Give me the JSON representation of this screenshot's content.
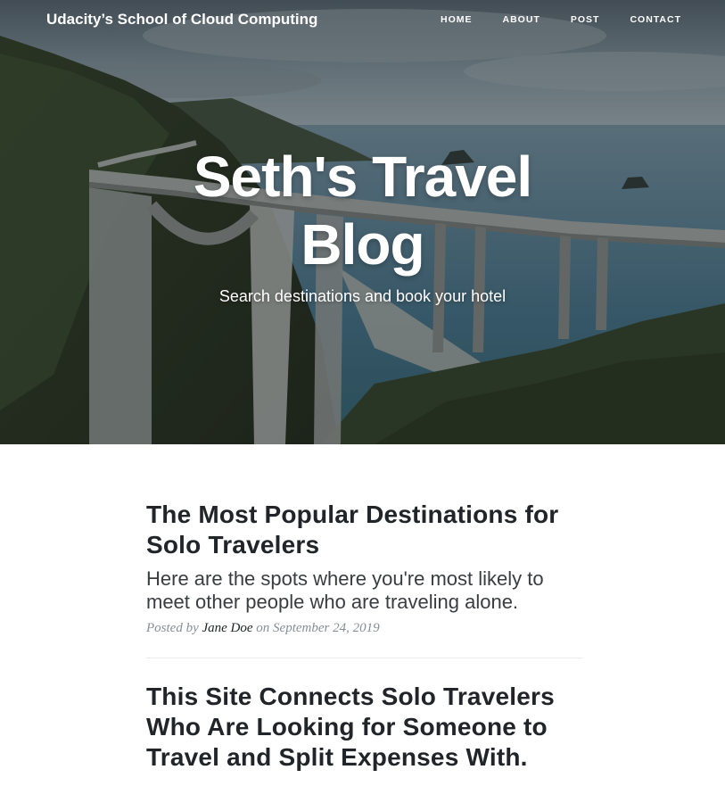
{
  "nav": {
    "brand": "Udacity’s School of Cloud Computing",
    "links": [
      "HOME",
      "ABOUT",
      "POST",
      "CONTACT"
    ]
  },
  "hero": {
    "title": "Seth's Travel Blog",
    "subtitle": "Search destinations and book your hotel"
  },
  "posts": [
    {
      "title": "The Most Popular Destinations for Solo Travelers",
      "subtitle": "Here are the spots where you're most likely to meet other people who are traveling alone.",
      "meta_prefix": "Posted by",
      "author": "Jane Doe",
      "meta_on": "on",
      "date": "September 24, 2019"
    },
    {
      "title": "This Site Connects Solo Travelers Who Are Looking for Someone to Travel and Split Expenses With."
    }
  ],
  "colors": {
    "text_dark": "#212529",
    "meta_gray": "#868e96",
    "divider": "#e9ecef"
  }
}
